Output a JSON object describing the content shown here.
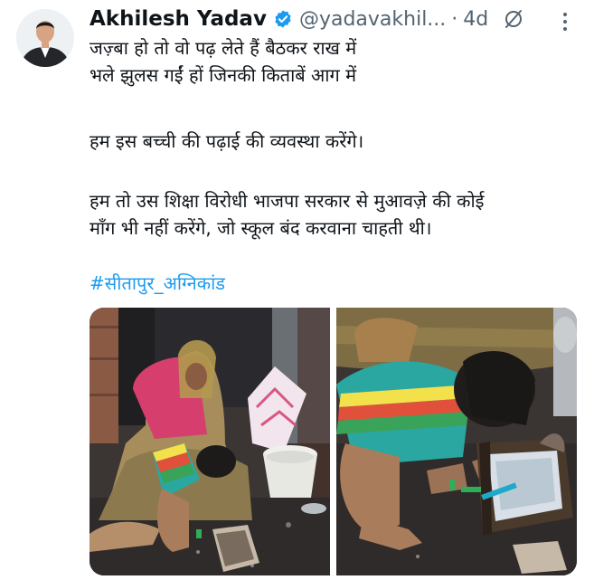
{
  "tweet": {
    "author_name": "Akhilesh Yadav",
    "handle": "@yadavakhil...",
    "separator": "·",
    "timestamp": "4d",
    "lines": [
      "जज़्बा हो तो वो पढ़ लेते हैं बैठकर राख में",
      "भले झुलस गईं हों जिनकी किताबें आग में",
      "हम इस बच्ची की पढ़ाई की व्यवस्था करेंगे।",
      "हम तो उस शिक्षा विरोधी भाजपा सरकार से मुआवज़े की कोई",
      "माँग भी नहीं करेंगे, जो स्कूल बंद करवाना चाहती थी।"
    ],
    "hashtag": "#सीतापुर_अग्निकांड",
    "media": [
      {
        "icon": "photo-woman-and-girl-in-ashes"
      },
      {
        "icon": "photo-girl-with-burnt-book"
      }
    ]
  },
  "icons": {
    "verified": "verified-badge-icon",
    "edited": "edited-icon",
    "more": "more-options-icon"
  },
  "colors": {
    "verified": "#1d9bf0",
    "hashtag": "#1d9bf0",
    "secondary_text": "#536471"
  }
}
